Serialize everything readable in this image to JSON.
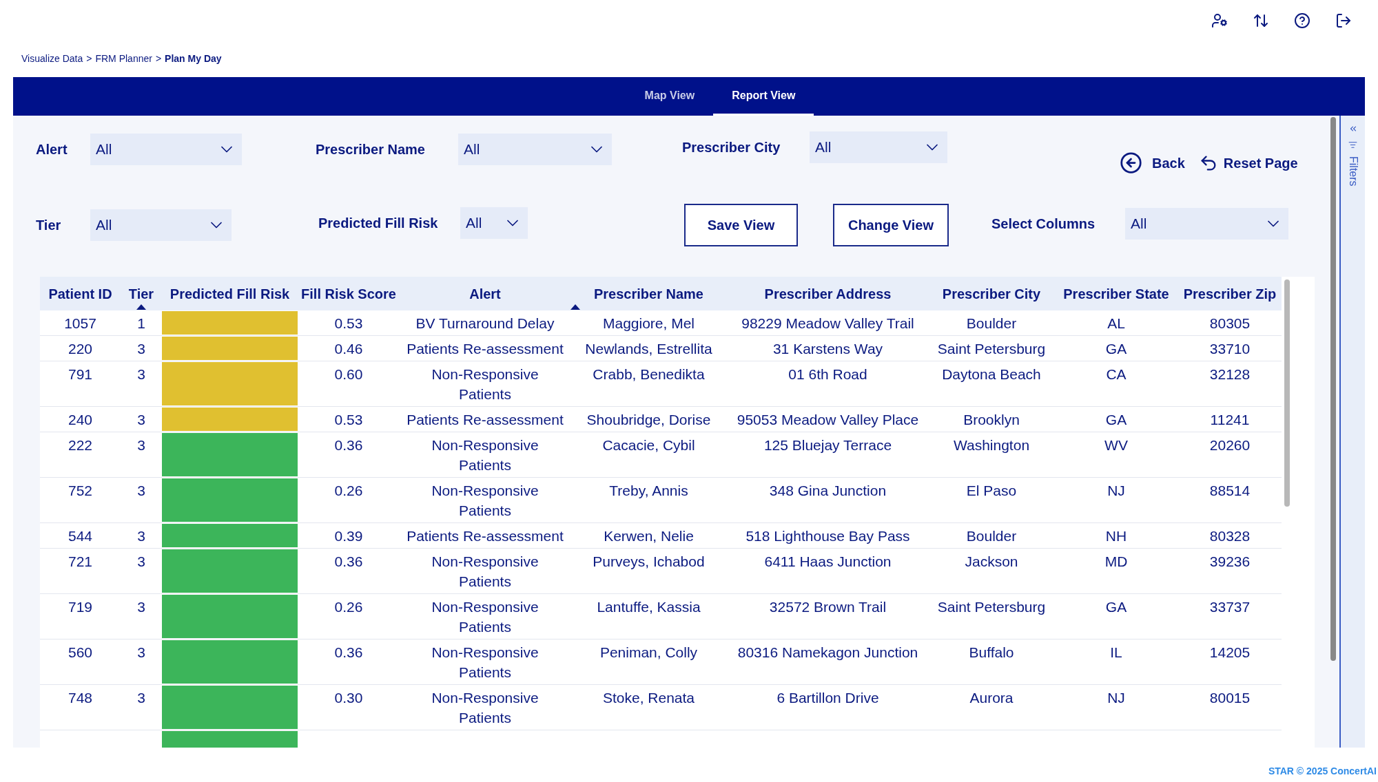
{
  "breadcrumb": [
    {
      "label": "Visualize Data",
      "current": false
    },
    {
      "label": "FRM Planner",
      "current": false
    },
    {
      "label": "Plan My Day",
      "current": true
    }
  ],
  "breadcrumb_separator": ">",
  "tabs": [
    {
      "label": "Map View",
      "selected": false
    },
    {
      "label": "Report View",
      "selected": true
    }
  ],
  "filters": {
    "alert": {
      "label": "Alert",
      "value": "All"
    },
    "prescriber_name": {
      "label": "Prescriber Name",
      "value": "All"
    },
    "prescriber_city": {
      "label": "Prescriber City",
      "value": "All"
    },
    "tier": {
      "label": "Tier",
      "value": "All"
    },
    "predicted_fill_risk": {
      "label": "Predicted Fill Risk",
      "value": "All"
    },
    "select_columns": {
      "label": "Select Columns",
      "value": "All"
    }
  },
  "buttons": {
    "back": "Back",
    "reset": "Reset Page",
    "save": "Save View",
    "change": "Change View"
  },
  "table": {
    "columns": [
      {
        "label": "Patient ID",
        "sorted": false
      },
      {
        "label": "Tier",
        "sorted": true
      },
      {
        "label": "Predicted Fill Risk",
        "sorted": false
      },
      {
        "label": "Fill Risk Score",
        "sorted": false
      },
      {
        "label": "Alert",
        "sorted": false
      },
      {
        "label": "Prescriber Name",
        "sorted": true
      },
      {
        "label": "Prescriber Address",
        "sorted": false
      },
      {
        "label": "Prescriber City",
        "sorted": false
      },
      {
        "label": "Prescriber State",
        "sorted": false
      },
      {
        "label": "Prescriber Zip",
        "sorted": false
      }
    ],
    "rows": [
      {
        "cells": [
          "1057",
          "1",
          "",
          "0.53",
          "BV Turnaround Delay",
          "Maggiore, Mel",
          "98229 Meadow Valley Trail",
          "Boulder",
          "AL",
          "80305"
        ],
        "color": "#e0c030"
      },
      {
        "cells": [
          "220",
          "3",
          "",
          "0.46",
          "Patients Re-assessment",
          "Newlands, Estrellita",
          "31 Karstens Way",
          "Saint Petersburg",
          "GA",
          "33710"
        ],
        "color": "#e0c030"
      },
      {
        "cells": [
          "791",
          "3",
          "",
          "0.60",
          "Non-Responsive Patients",
          "Crabb, Benedikta",
          "01 6th Road",
          "Daytona Beach",
          "CA",
          "32128"
        ],
        "color": "#e0c030"
      },
      {
        "cells": [
          "240",
          "3",
          "",
          "0.53",
          "Patients Re-assessment",
          "Shoubridge, Dorise",
          "95053 Meadow Valley Place",
          "Brooklyn",
          "GA",
          "11241"
        ],
        "color": "#e0c030"
      },
      {
        "cells": [
          "222",
          "3",
          "",
          "0.36",
          "Non-Responsive Patients",
          "Cacacie, Cybil",
          "125 Bluejay Terrace",
          "Washington",
          "WV",
          "20260"
        ],
        "color": "#3cb55a"
      },
      {
        "cells": [
          "752",
          "3",
          "",
          "0.26",
          "Non-Responsive Patients",
          "Treby, Annis",
          "348 Gina Junction",
          "El Paso",
          "NJ",
          "88514"
        ],
        "color": "#3cb55a"
      },
      {
        "cells": [
          "544",
          "3",
          "",
          "0.39",
          "Patients Re-assessment",
          "Kerwen, Nelie",
          "518 Lighthouse Bay Pass",
          "Boulder",
          "NH",
          "80328"
        ],
        "color": "#3cb55a"
      },
      {
        "cells": [
          "721",
          "3",
          "",
          "0.36",
          "Non-Responsive Patients",
          "Purveys, Ichabod",
          "6411 Haas Junction",
          "Jackson",
          "MD",
          "39236"
        ],
        "color": "#3cb55a"
      },
      {
        "cells": [
          "719",
          "3",
          "",
          "0.26",
          "Non-Responsive Patients",
          "Lantuffe, Kassia",
          "32572 Brown Trail",
          "Saint Petersburg",
          "GA",
          "33737"
        ],
        "color": "#3cb55a"
      },
      {
        "cells": [
          "560",
          "3",
          "",
          "0.36",
          "Non-Responsive Patients",
          "Peniman, Colly",
          "80316 Namekagon Junction",
          "Buffalo",
          "IL",
          "14205"
        ],
        "color": "#3cb55a"
      },
      {
        "cells": [
          "748",
          "3",
          "",
          "0.30",
          "Non-Responsive Patients",
          "Stoke, Renata",
          "6 Bartillon Drive",
          "Aurora",
          "NJ",
          "80015"
        ],
        "color": "#3cb55a"
      },
      {
        "cells": [
          "",
          "",
          "",
          "",
          "",
          "",
          "",
          "",
          "",
          ""
        ],
        "color": "#3cb55a"
      }
    ]
  },
  "filter_pane": {
    "label": "Filters"
  },
  "footer": "STAR © 2025 ConcertAI"
}
